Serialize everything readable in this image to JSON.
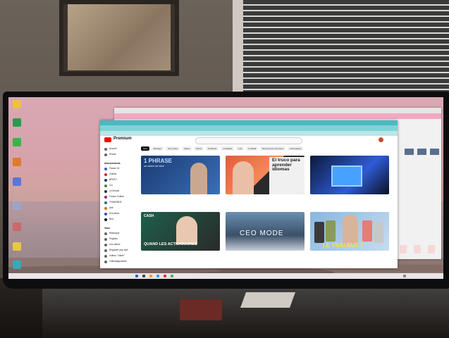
{
  "scene": {
    "description_free": true
  },
  "browser": {
    "app_name": "Premium",
    "chips": [
      "Tout",
      "Musique",
      "Jeux vidéo",
      "Mixes",
      "Direct",
      "Podcasts",
      "Actualités",
      "Info",
      "Football",
      "Récemment importées",
      "Nouveautés"
    ],
    "sidebar_top": [
      "Accueil",
      "Shorts"
    ],
    "sidebar_section": "Abonnements",
    "sidebar_subs": [
      "France 24",
      "CNews",
      "BFMTV",
      "LCI",
      "Le Monde",
      "France Culture",
      "TV5MONDE",
      "Arte",
      "Euronews",
      "Brut"
    ],
    "sidebar_you_label": "Vous",
    "sidebar_you": [
      "Historique",
      "Playlists",
      "Vos vidéos",
      "Regarder plus tard",
      "Vidéos \"J'aime\"",
      "Téléchargements"
    ]
  },
  "videos": [
    {
      "overlay": "1 PHRASE",
      "overlay_small": "un cocher de vivre",
      "title": "",
      "meta": ""
    },
    {
      "overlay": "",
      "title": "",
      "meta": ""
    },
    {
      "overlay": "El truco para aprender idiomas",
      "title": "",
      "meta": ""
    },
    {
      "overlay": "",
      "title": "",
      "meta": ""
    },
    {
      "overlay": "CASH",
      "overlay_bottom": "QUAND LES ACTIONNAIRES",
      "title": "",
      "meta": ""
    },
    {
      "overlay": "CEO MODE",
      "title": "",
      "meta": ""
    },
    {
      "overlay": "LE VRAI BUT ?",
      "title": "",
      "meta": ""
    }
  ],
  "colors": {
    "youtube_red": "#ff0000",
    "tab_bar": "#4cb8c0",
    "address_bar": "#7fd3d7",
    "background_window_bar": "#f3a8c1",
    "wallpaper_top": "#d9a8b4"
  }
}
